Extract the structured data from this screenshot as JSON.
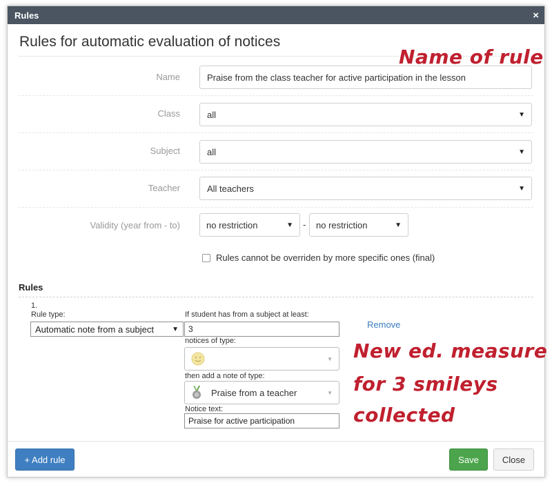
{
  "titlebar": {
    "title": "Rules",
    "close_glyph": "×"
  },
  "dialog_heading": "Rules for automatic evaluation of notices",
  "form": {
    "name_label": "Name",
    "name_value": "Praise from the class teacher for active participation in the lesson",
    "class_label": "Class",
    "class_value": "all",
    "subject_label": "Subject",
    "subject_value": "all",
    "teacher_label": "Teacher",
    "teacher_value": "All teachers",
    "validity_label": "Validity (year from - to)",
    "validity_from": "no restriction",
    "validity_separator": "-",
    "validity_to": "no restriction",
    "final_checkbox_label": "Rules cannot be overriden by more specific ones (final)",
    "final_checked": false
  },
  "rules_section": {
    "title": "Rules",
    "rules": [
      {
        "number": "1.",
        "rule_type_label": "Rule type:",
        "rule_type_value": "Automatic note from a subject",
        "count_label": "If student has from a subject at least:",
        "count_value": "3",
        "notices_type_label": "notices of type:",
        "notices_type_icon": "smiley-icon",
        "then_add_label": "then add a note of type:",
        "then_add_value": "Praise from a teacher",
        "then_add_icon": "medal-icon",
        "notice_text_label": "Notice text:",
        "notice_text_value": "Praise for active participation",
        "remove_label": "Remove"
      }
    ]
  },
  "buttons": {
    "add_rule": "+ Add rule",
    "save": "Save",
    "close": "Close"
  },
  "annotations": {
    "name_note": "Name of rule",
    "measure_note_line1": "New ed. measure",
    "measure_note_line2": "for 3 smileys",
    "measure_note_line3": "collected"
  },
  "colors": {
    "titlebar": "#4a5561",
    "primary": "#3f7fc1",
    "success": "#4ca54c",
    "link": "#3a7bbf",
    "annotation": "#c0202f"
  }
}
